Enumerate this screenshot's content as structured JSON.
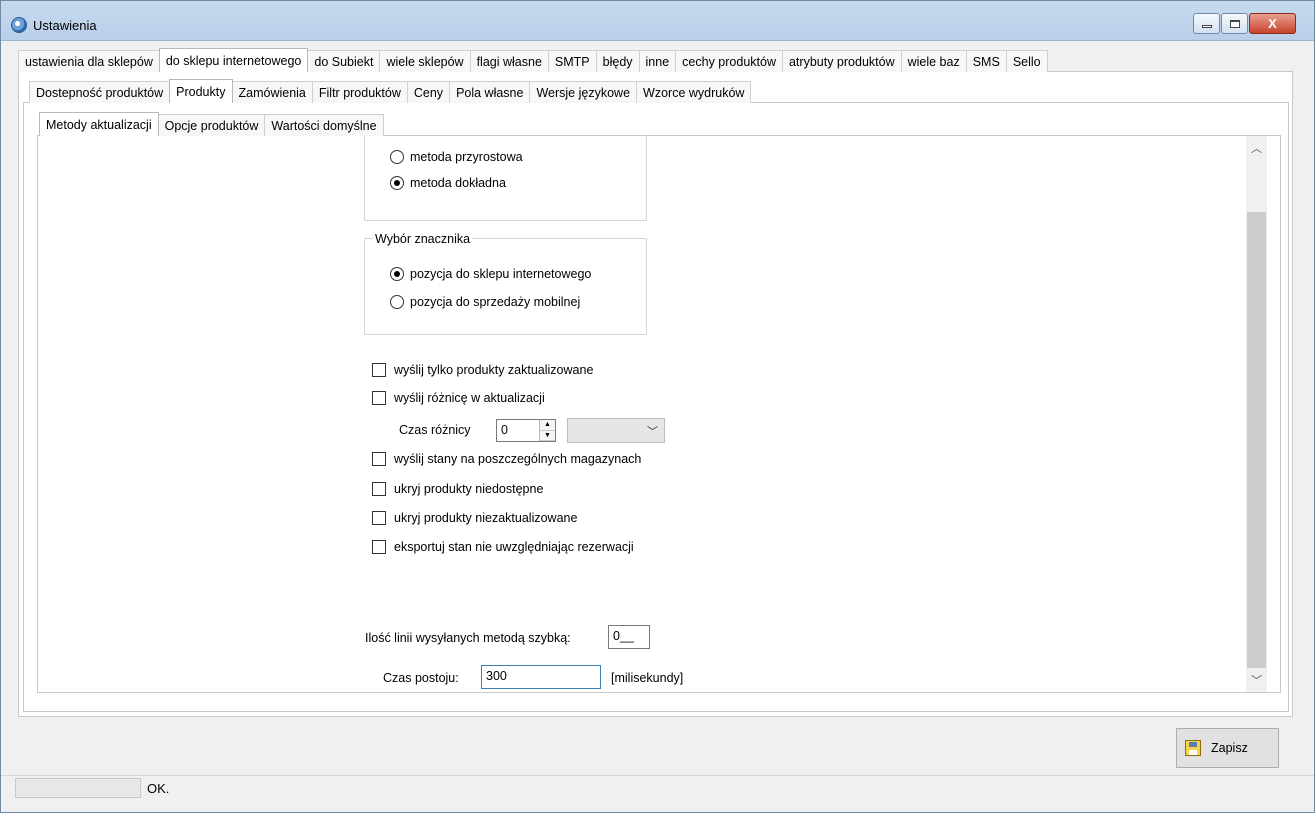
{
  "window": {
    "title": "Ustawienia",
    "minimize": "–",
    "maximize": "□",
    "close": "X"
  },
  "tabs_level1": [
    "ustawienia dla sklepów",
    "do sklepu internetowego",
    "do Subiekt",
    "wiele sklepów",
    "flagi własne",
    "SMTP",
    "błędy",
    "inne",
    "cechy produktów",
    "atrybuty produktów",
    "wiele baz",
    "SMS",
    "Sello"
  ],
  "tabs_level1_active": 1,
  "tabs_level2": [
    "Dostepność produktów",
    "Produkty",
    "Zamówienia",
    "Filtr produktów",
    "Ceny",
    "Pola własne",
    "Wersje językowe",
    "Wzorce wydruków"
  ],
  "tabs_level2_active": 1,
  "tabs_level3": [
    "Metody aktualizacji",
    "Opcje produktów",
    "Wartości domyślne"
  ],
  "tabs_level3_active": 0,
  "method_group": {
    "options": [
      {
        "label": "metoda przyrostowa",
        "selected": false
      },
      {
        "label": "metoda dokładna",
        "selected": true
      }
    ]
  },
  "marker_group": {
    "legend": "Wybór znacznika",
    "options": [
      {
        "label": "pozycja do sklepu internetowego",
        "selected": true
      },
      {
        "label": "pozycja do sprzedaży mobilnej",
        "selected": false
      }
    ]
  },
  "checkboxes": [
    {
      "label": "wyślij tylko produkty zaktualizowane",
      "checked": false
    },
    {
      "label": "wyślij różnicę w aktualizacji",
      "checked": false
    },
    {
      "label": "wyślij stany na poszczególnych magazynach",
      "checked": false
    },
    {
      "label": "ukryj produkty niedostępne",
      "checked": false
    },
    {
      "label": "ukryj produkty niezaktualizowane",
      "checked": false
    },
    {
      "label": "eksportuj stan nie uwzględniając rezerwacji",
      "checked": false
    }
  ],
  "diff_time": {
    "label": "Czas różnicy",
    "value": "0",
    "unit_value": ""
  },
  "lines_fast": {
    "label": "Ilość linii wysyłanych metodą szybką:",
    "value": "0__"
  },
  "pause": {
    "label": "Czas postoju:",
    "value": "300",
    "unit": "[milisekundy]"
  },
  "save_button": {
    "label": "Zapisz"
  },
  "status": {
    "text": "OK."
  }
}
